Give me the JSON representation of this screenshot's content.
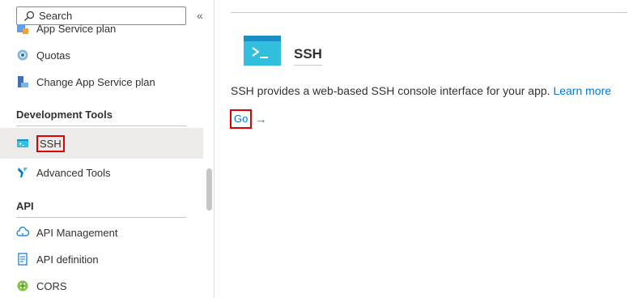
{
  "sidebar": {
    "search": {
      "placeholder": "Search"
    },
    "collapse_glyph": "«",
    "partial_item": {
      "label": "App Service plan",
      "icon": "app-service-plan-icon"
    },
    "items_top": [
      {
        "label": "Quotas",
        "icon": "quotas-icon"
      },
      {
        "label": "Change App Service plan",
        "icon": "change-plan-icon"
      }
    ],
    "sections": [
      {
        "title": "Development Tools",
        "items": [
          {
            "label": "SSH",
            "icon": "ssh-console-icon",
            "selected": true
          },
          {
            "label": "Advanced Tools",
            "icon": "advanced-tools-icon"
          }
        ]
      },
      {
        "title": "API",
        "items": [
          {
            "label": "API Management",
            "icon": "api-management-cloud-icon"
          },
          {
            "label": "API definition",
            "icon": "api-definition-icon"
          },
          {
            "label": "CORS",
            "icon": "cors-icon"
          }
        ]
      }
    ]
  },
  "main": {
    "title": "SSH",
    "description": "SSH provides a web-based SSH console interface for your app.",
    "learn_more": "Learn more",
    "go_label": "Go",
    "go_arrow": "→"
  },
  "colors": {
    "accent": "#0078d4",
    "highlight": "#e00000",
    "selected_bg": "#edebe9"
  }
}
